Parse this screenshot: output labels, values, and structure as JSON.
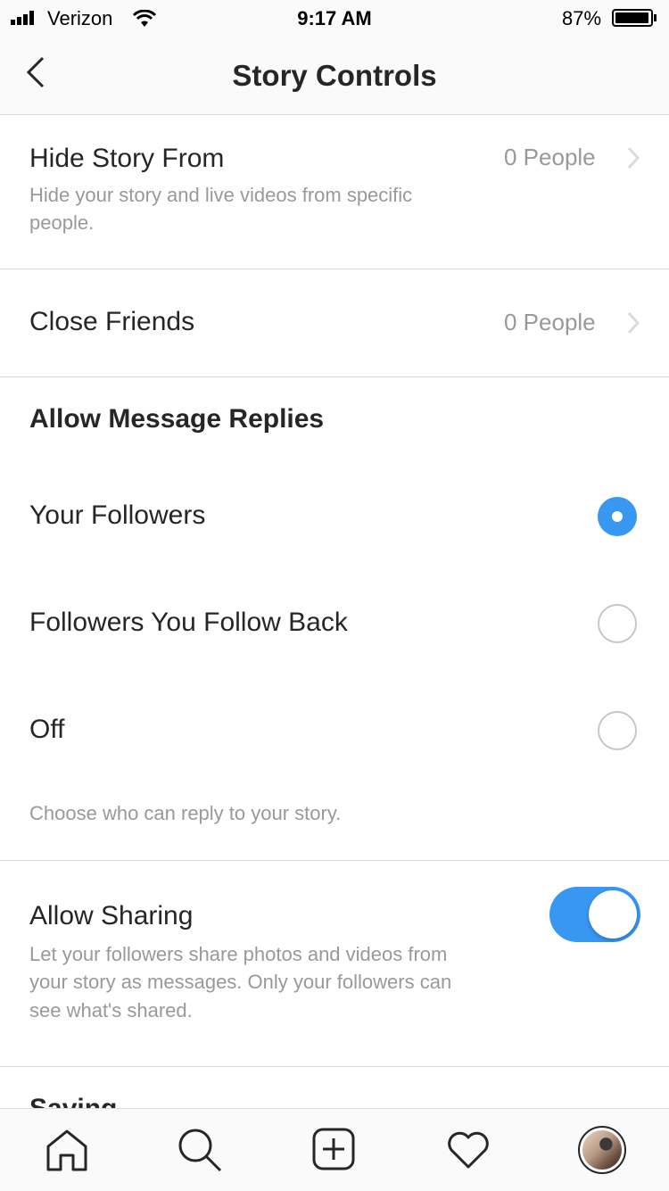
{
  "status_bar": {
    "carrier": "Verizon",
    "time": "9:17 AM",
    "battery_percent": "87%",
    "battery_level": 0.87
  },
  "header": {
    "title": "Story Controls",
    "back_icon": "chevron-left-icon"
  },
  "hide_story": {
    "title": "Hide Story From",
    "value": "0 People",
    "description_line1": "Hide your story and live videos from specific",
    "description_line2": "people."
  },
  "close_friends": {
    "title": "Close Friends",
    "value": "0 People"
  },
  "message_replies": {
    "title": "Allow Message Replies",
    "options": [
      {
        "label": "Your Followers",
        "selected": true
      },
      {
        "label": "Followers You Follow Back",
        "selected": false
      },
      {
        "label": "Off",
        "selected": false
      }
    ],
    "description": "Choose who can reply to your story."
  },
  "allow_sharing": {
    "title": "Allow Sharing",
    "enabled": true,
    "description_line1": "Let your followers share photos and videos from",
    "description_line2": "your story as messages. Only your followers can",
    "description_line3": "see what's shared."
  },
  "saving": {
    "title": "Saving"
  },
  "bottom_nav": {
    "items": [
      "home-icon",
      "search-icon",
      "add-post-icon",
      "heart-icon",
      "profile-avatar"
    ]
  },
  "colors": {
    "accent": "#3897f0",
    "text": "#262626",
    "secondary_text": "#999999",
    "divider": "#dbdbdb"
  }
}
